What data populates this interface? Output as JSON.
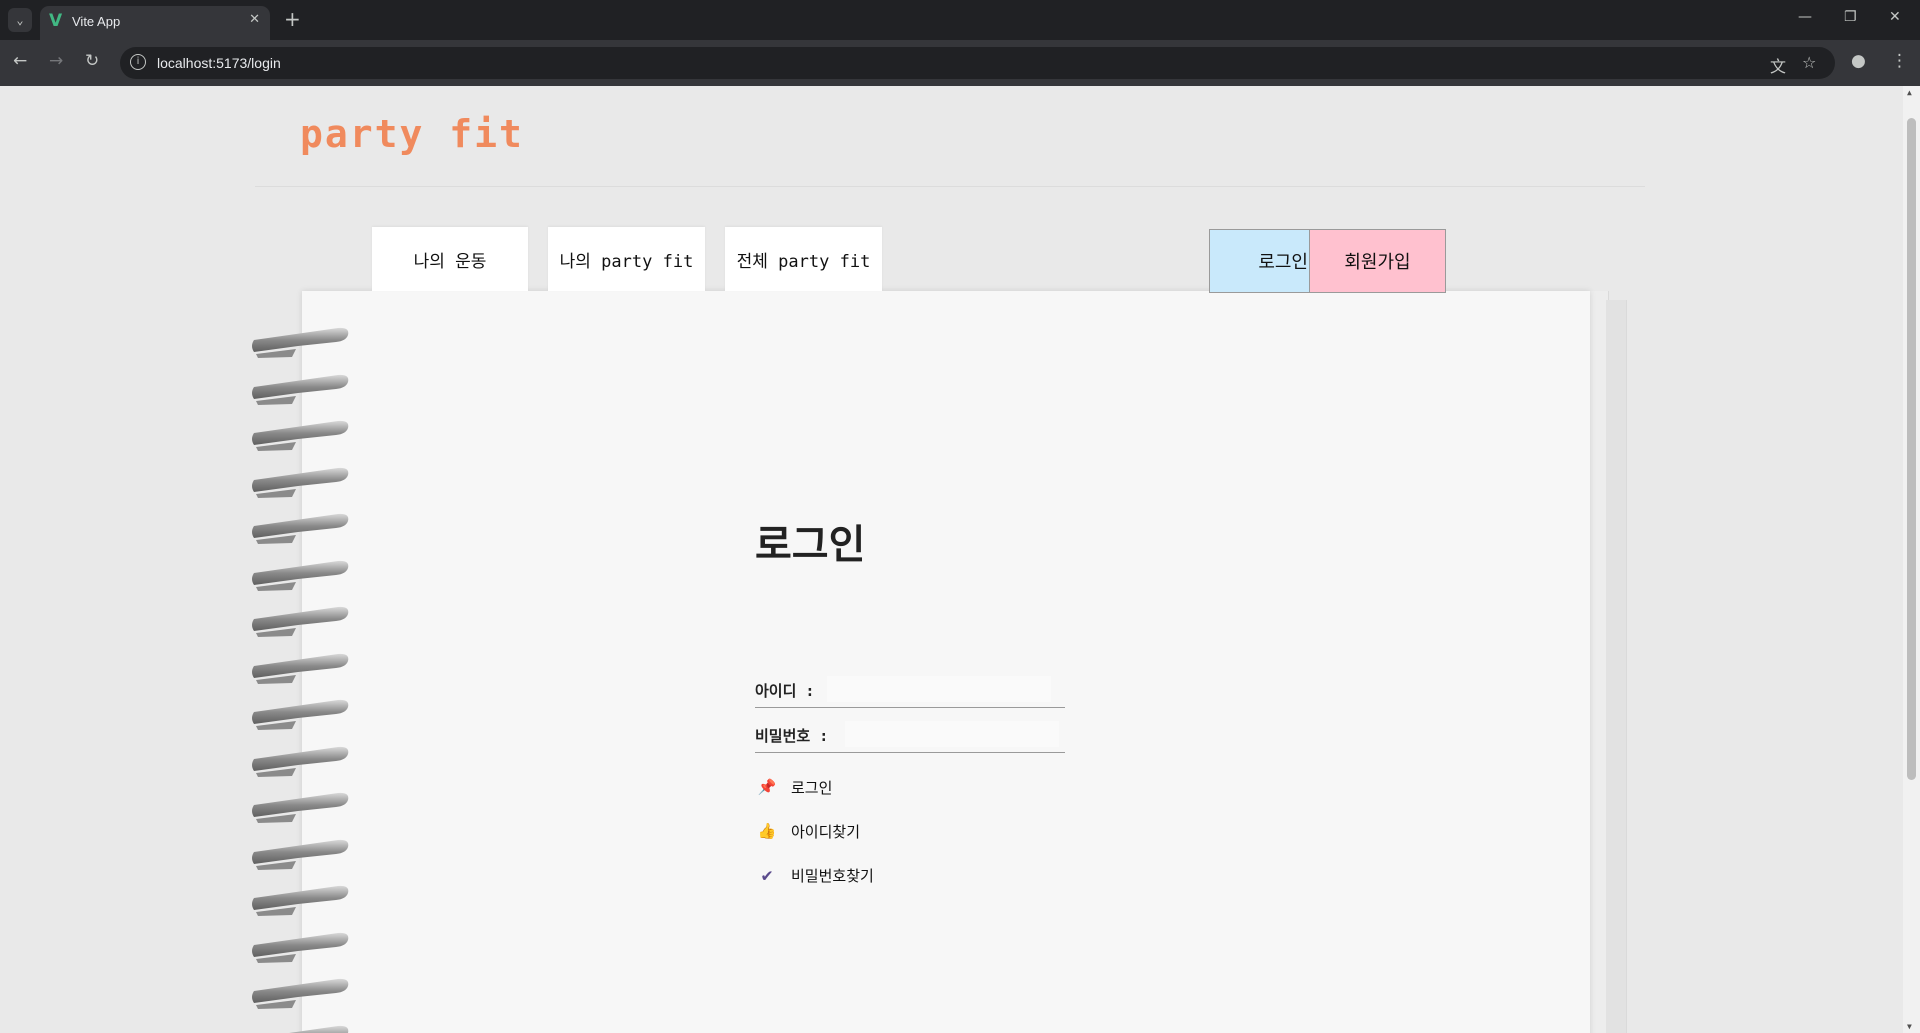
{
  "browser": {
    "tab_title": "Vite App",
    "tab_favicon": "V",
    "url": "localhost:5173/login",
    "icons": [
      "tab-search-icon",
      "close-icon",
      "new-tab-icon",
      "minimize-icon",
      "restore-icon",
      "window-close-icon",
      "back-icon",
      "forward-icon",
      "reload-icon",
      "site-info-icon",
      "translate-icon",
      "bookmark-star-icon",
      "profile-icon",
      "menu-icon"
    ]
  },
  "header": {
    "logo": "party fit",
    "logo_color": "#f08a5d"
  },
  "nav": {
    "tabs": [
      {
        "label": "나의 운동"
      },
      {
        "label": "나의 party fit"
      },
      {
        "label": "전체 party fit"
      }
    ]
  },
  "auth": {
    "login_label": "로그인",
    "login_color": "#c9e9fb",
    "signup_label": "회원가입",
    "signup_color": "#ffc1cf"
  },
  "login_form": {
    "title": "로그인",
    "id_label": "아이디 :",
    "id_value": "",
    "password_label": "비밀번호 :",
    "password_value": "",
    "actions": [
      {
        "icon": "pushpin-icon",
        "glyph": "📌",
        "label": "로그인"
      },
      {
        "icon": "thumbs-up-icon",
        "glyph": "👍",
        "label": "아이디찾기"
      },
      {
        "icon": "checkmark-icon",
        "glyph": "✔",
        "label": "비밀번호찾기"
      }
    ]
  }
}
